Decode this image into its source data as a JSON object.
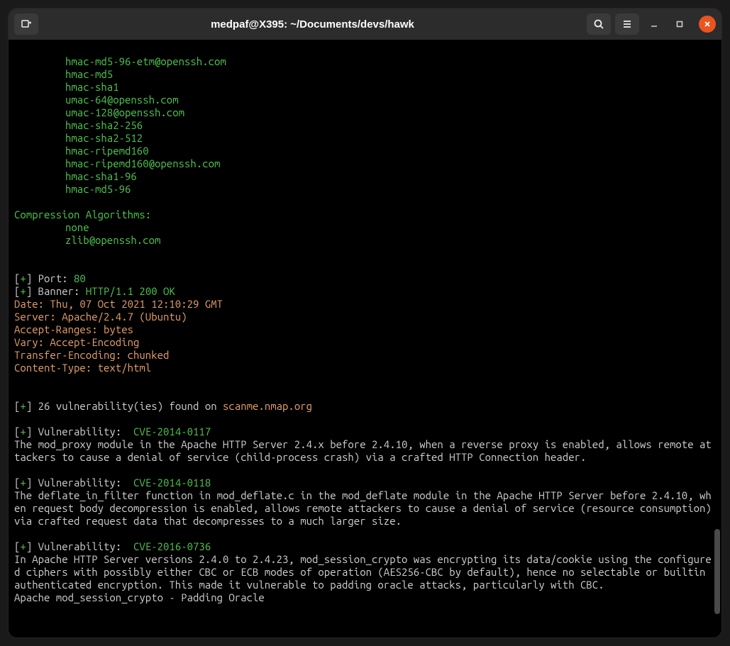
{
  "window": {
    "title": "medpaf@X395: ~/Documents/devs/hawk"
  },
  "mac_algorithms": [
    "hmac-md5-96-etm@openssh.com",
    "hmac-md5",
    "hmac-sha1",
    "umac-64@openssh.com",
    "umac-128@openssh.com",
    "hmac-sha2-256",
    "hmac-sha2-512",
    "hmac-ripemd160",
    "hmac-ripemd160@openssh.com",
    "hmac-sha1-96",
    "hmac-md5-96"
  ],
  "compression_label": "Compression Algorithms:",
  "compression_algorithms": [
    "none",
    "zlib@openssh.com"
  ],
  "port": {
    "prefix_l": "[",
    "prefix_p": "+",
    "prefix_r": "] Port: ",
    "value": "80"
  },
  "banner": {
    "prefix_l": "[",
    "prefix_p": "+",
    "prefix_r": "] Banner: ",
    "value": "HTTP/1.1 200 OK"
  },
  "headers": [
    "Date: Thu, 07 Oct 2021 12:10:29 GMT",
    "Server: Apache/2.4.7 (Ubuntu)",
    "Accept-Ranges: bytes",
    "Vary: Accept-Encoding",
    "Transfer-Encoding: chunked",
    "Content-Type: text/html"
  ],
  "vuln_summary": {
    "prefix_l": "[",
    "prefix_p": "+",
    "prefix_r": "] 26 vulnerability(ies) found on ",
    "host": "scanme.nmap.org"
  },
  "vulns": [
    {
      "label": "] Vulnerability:  ",
      "cve": "CVE-2014-0117",
      "desc": "The mod_proxy module in the Apache HTTP Server 2.4.x before 2.4.10, when a reverse proxy is enabled, allows remote attackers to cause a denial of service (child-process crash) via a crafted HTTP Connection header."
    },
    {
      "label": "] Vulnerability:  ",
      "cve": "CVE-2014-0118",
      "desc": "The deflate_in_filter function in mod_deflate.c in the mod_deflate module in the Apache HTTP Server before 2.4.10, when request body decompression is enabled, allows remote attackers to cause a denial of service (resource consumption) via crafted request data that decompresses to a much larger size."
    },
    {
      "label": "] Vulnerability:  ",
      "cve": "CVE-2016-0736",
      "desc": "In Apache HTTP Server versions 2.4.0 to 2.4.23, mod_session_crypto was encrypting its data/cookie using the configured ciphers with possibly either CBC or ECB modes of operation (AES256-CBC by default), hence no selectable or builtin authenticated encryption. This made it vulnerable to padding oracle attacks, particularly with CBC.\nApache mod_session_crypto - Padding Oracle"
    }
  ],
  "bracket": {
    "l": "[",
    "p": "+"
  }
}
